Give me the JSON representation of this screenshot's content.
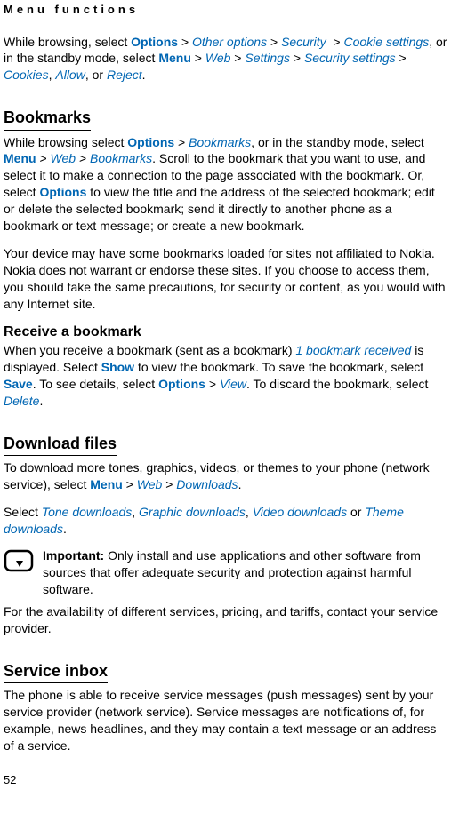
{
  "header": "Menu functions",
  "intro": {
    "p1a": "While browsing, select ",
    "options": "Options",
    "gt": " > ",
    "other_options": "Other options",
    "security": "Security",
    "cookie_settings": "Cookie settings",
    "p1b": ", or in the standby mode, select ",
    "menu": "Menu",
    "web": "Web",
    "settings": "Settings",
    "security_settings": "Security settings",
    "cookies": "Cookies",
    "allow": "Allow",
    "reject": "Reject",
    "comma": ", ",
    "or": ", or ",
    "period": "."
  },
  "bookmarks": {
    "title": "Bookmarks",
    "p1a": "While browsing select ",
    "options": "Options",
    "bookmarks": "Bookmarks",
    "p1b": ", or in the standby mode, select ",
    "menu": "Menu",
    "web": "Web",
    "p1c": ". Scroll to the bookmark that you want to use, and select it to make a connection to the page associated with the bookmark. Or, select ",
    "options2": "Options",
    "p1d": " to view the title and the address of the selected bookmark; edit or delete the selected bookmark; send it directly to another phone as a bookmark or text message; or create a new bookmark.",
    "p2": "Your device may have some bookmarks loaded for sites not affiliated to Nokia. Nokia does not warrant or endorse these sites. If you choose to access them, you should take the same precautions, for security or content, as you would with any Internet site."
  },
  "receive": {
    "title": "Receive a bookmark",
    "p1a": "When you receive a bookmark (sent as a bookmark) ",
    "received": "1 bookmark received",
    "p1b": " is displayed. Select ",
    "show": "Show",
    "p1c": " to view the bookmark. To save the bookmark, select ",
    "save": "Save",
    "p1d": ". To see details, select ",
    "options": "Options",
    "view": "View",
    "p1e": ". To discard the bookmark, select ",
    "delete": "Delete",
    "period": "."
  },
  "download": {
    "title": "Download files",
    "p1a": "To download more tones, graphics, videos, or themes to your phone (network service), select ",
    "menu": "Menu",
    "web": "Web",
    "downloads": "Downloads",
    "p2a": "Select ",
    "tone": "Tone downloads",
    "graphic": "Graphic downloads",
    "video": "Video downloads",
    "theme": "Theme downloads",
    "or": " or ",
    "comma": ", ",
    "period": ".",
    "important_label": "Important:",
    "important_text": " Only install and use applications and other software from sources that offer adequate security and protection against harmful software.",
    "p3": "For the availability of different services, pricing, and tariffs, contact your service provider."
  },
  "inbox": {
    "title": "Service inbox",
    "p1": "The phone is able to receive service messages (push messages) sent by your service provider (network service). Service messages are notifications of, for example, news headlines, and they may contain a text message or an address of a service."
  },
  "page_number": "52",
  "gt": " > "
}
